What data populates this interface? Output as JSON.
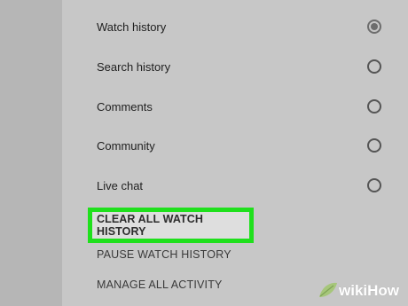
{
  "options": [
    {
      "label": "Watch history",
      "selected": true
    },
    {
      "label": "Search history",
      "selected": false
    },
    {
      "label": "Comments",
      "selected": false
    },
    {
      "label": "Community",
      "selected": false
    },
    {
      "label": "Live chat",
      "selected": false
    }
  ],
  "actions": {
    "clear_all": "CLEAR ALL WATCH HISTORY",
    "pause": "PAUSE WATCH HISTORY",
    "manage": "MANAGE ALL ACTIVITY"
  },
  "watermark": {
    "text": "wikiHow"
  },
  "colors": {
    "highlight": "#1fe01c",
    "panel": "#c7c7c7",
    "left_bar": "#b6b6b6"
  }
}
